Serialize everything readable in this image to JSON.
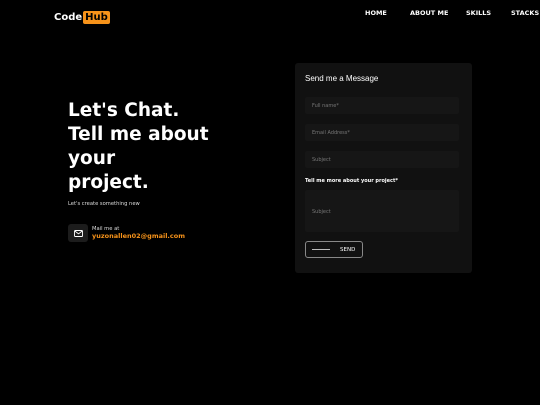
{
  "logo": {
    "part1": "Code",
    "part2": "Hub"
  },
  "nav": [
    {
      "label": "HOME"
    },
    {
      "label": "ABOUT ME"
    },
    {
      "label": "SKILLS"
    },
    {
      "label": "STACKS"
    }
  ],
  "hero": {
    "title_lines": [
      "Let's Chat.",
      "Tell me about",
      "your",
      "project."
    ],
    "subtitle": "Let's create something new"
  },
  "contact": {
    "mail_label": "Mail me at",
    "mail_value": "yuzonallen02@gmail.com",
    "icon": "mail-icon"
  },
  "form": {
    "title": "Send me a Message",
    "fullname_placeholder": "Full name*",
    "email_placeholder": "Email Address*",
    "subject_placeholder": "Subject",
    "message_label": "Tell me more about your project*",
    "message_placeholder": "Subject",
    "send_label": "SEND"
  },
  "colors": {
    "accent": "#f7931a",
    "background": "#000000",
    "card": "#111111"
  }
}
